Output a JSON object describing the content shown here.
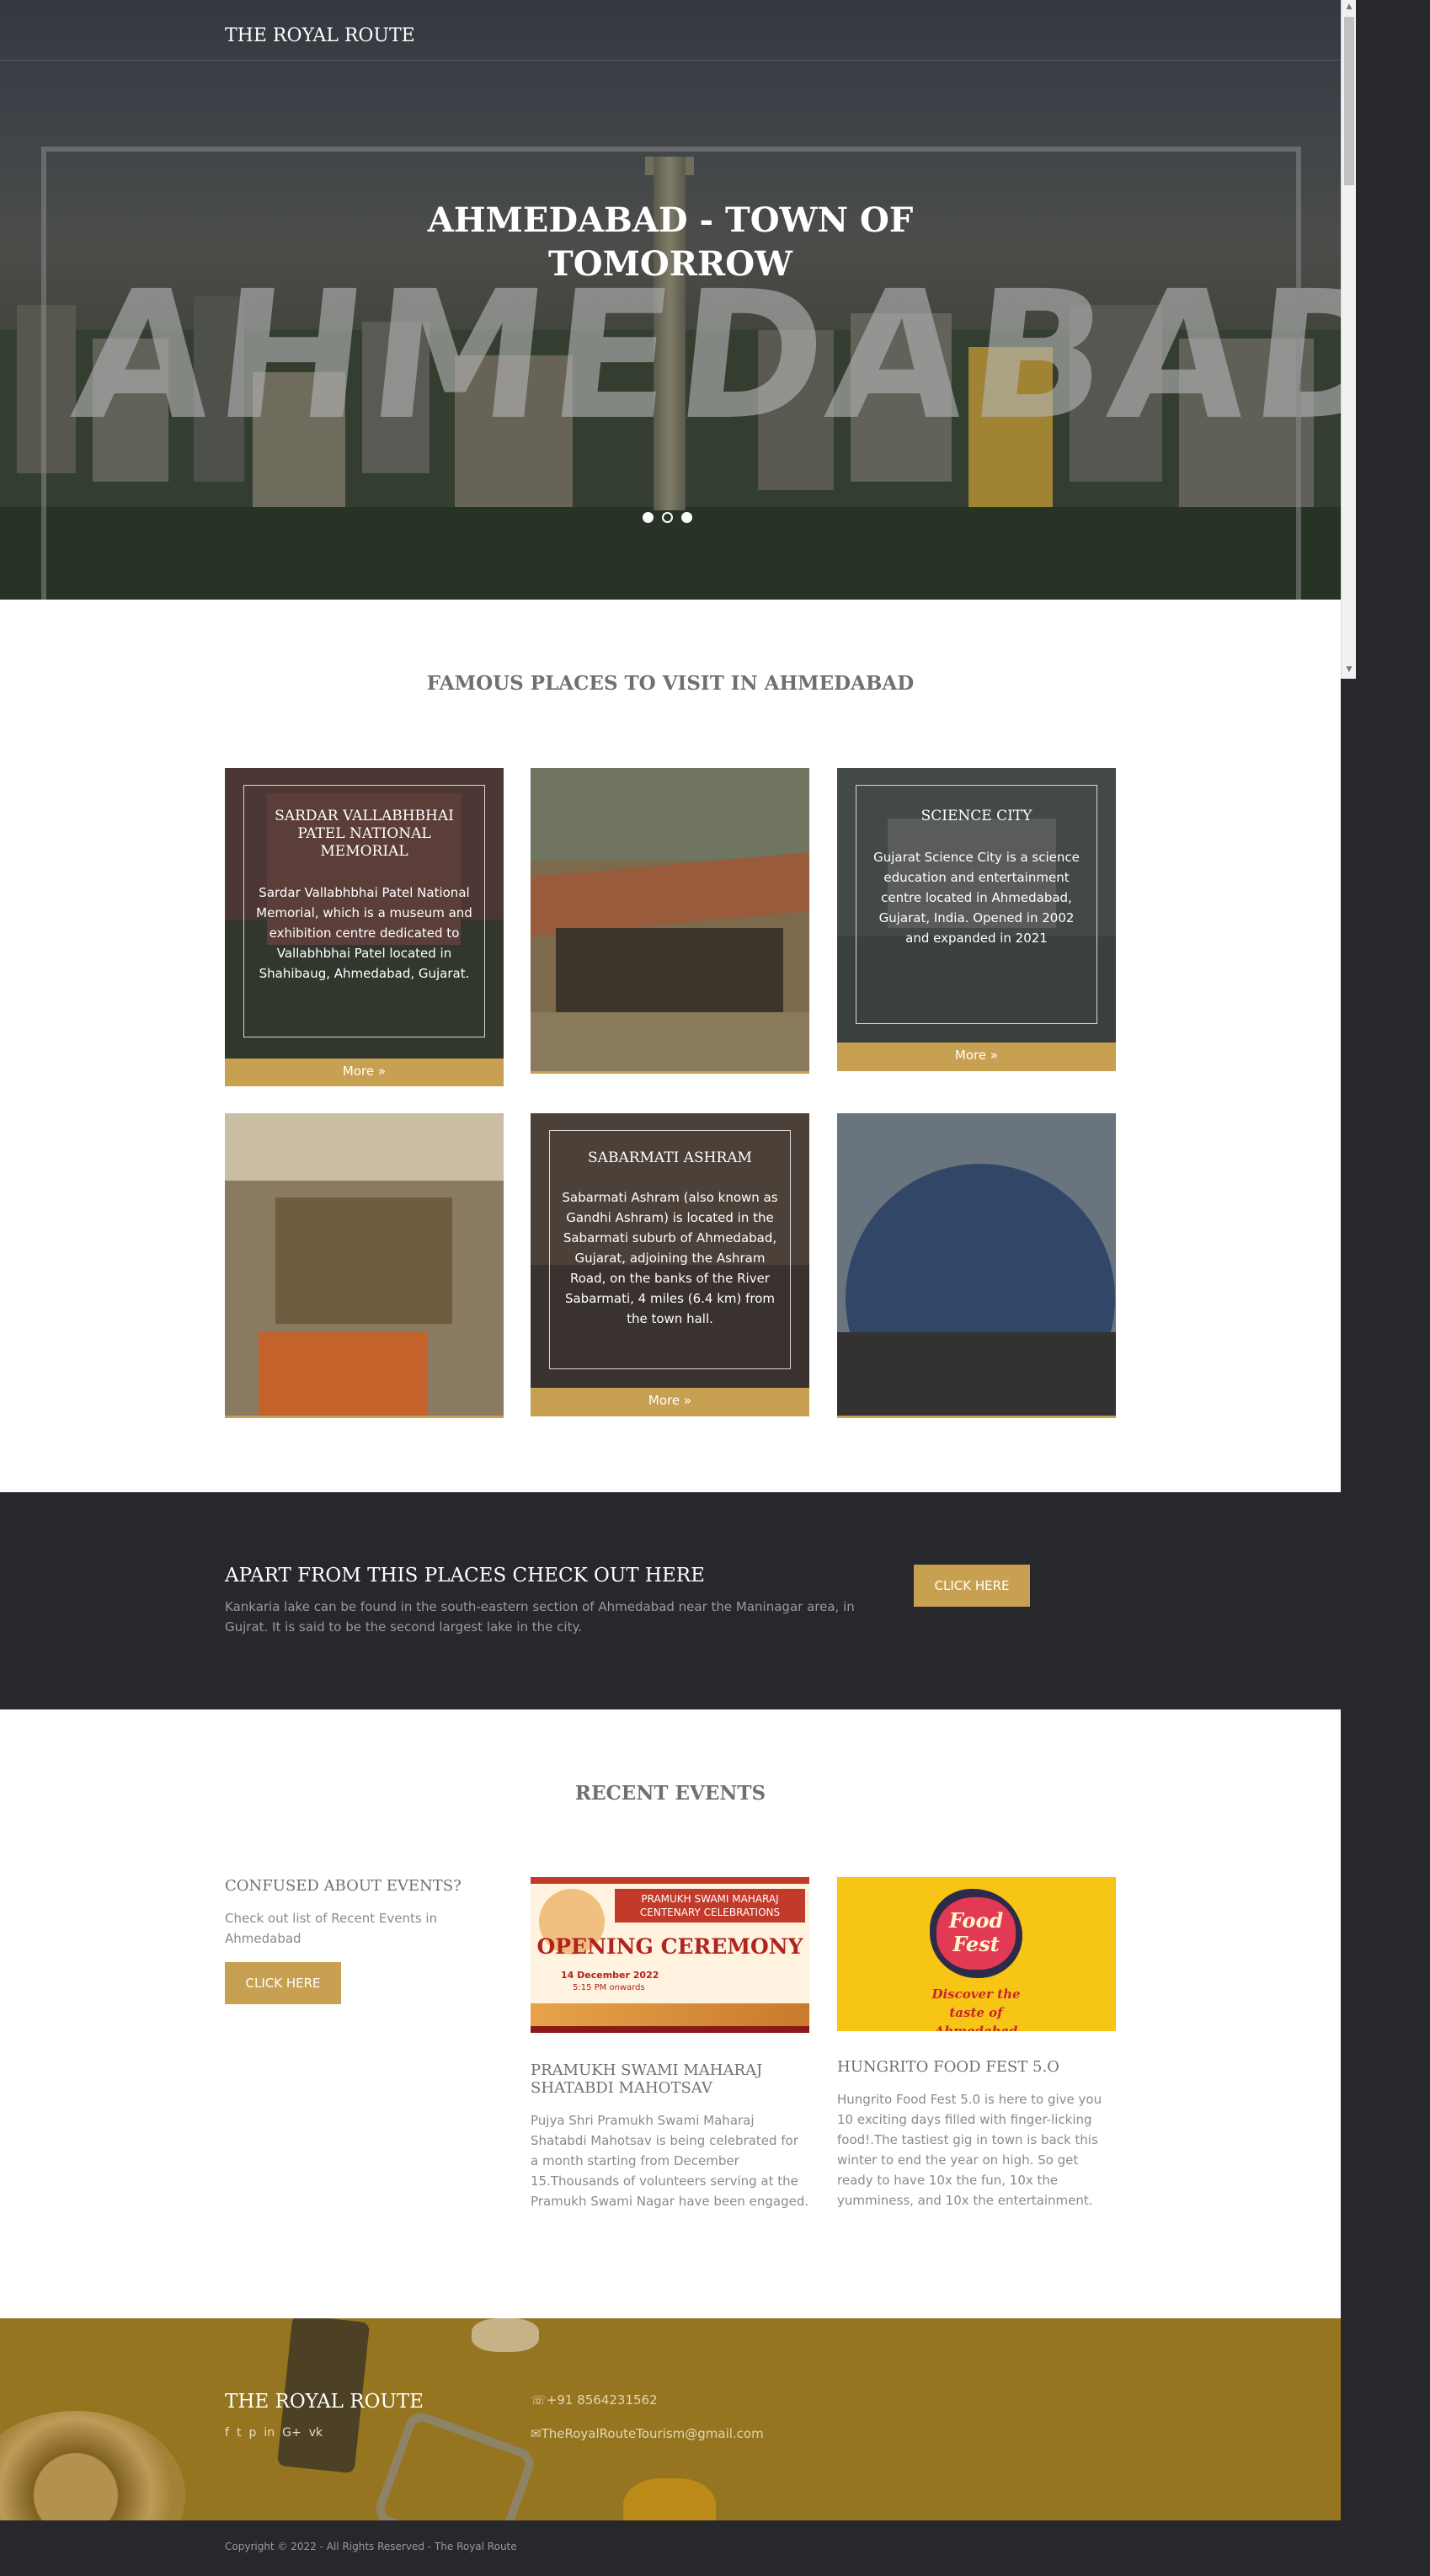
{
  "header": {
    "brand": "THE ROYAL ROUTE"
  },
  "hero": {
    "title_line1": "AHMEDABAD - TOWN OF",
    "title_line2": "TOMORROW",
    "background_word": "AHMEDABAD",
    "slides": 3,
    "active_slide": 1
  },
  "famous": {
    "title": "FAMOUS PLACES TO VISIT IN AHMEDABAD",
    "cards": [
      {
        "title": "SARDAR VALLABHBHAI PATEL NATIONAL MEMORIAL",
        "text": "Sardar Vallabhbhai Patel National Memorial, which is a museum and exhibition centre dedicated to Vallabhbhai Patel located in Shahibaug, Ahmedabad, Gujarat.",
        "more": "More »"
      },
      {
        "title": "",
        "text": "",
        "more": ""
      },
      {
        "title": "SCIENCE CITY",
        "text": "Gujarat Science City is a science education and entertainment centre located in Ahmedabad, Gujarat, India. Opened in 2002 and expanded in 2021",
        "more": "More »"
      },
      {
        "title": "",
        "text": "",
        "more": ""
      },
      {
        "title": "SABARMATI ASHRAM",
        "text": "Sabarmati Ashram (also known as Gandhi Ashram) is located in the Sabarmati suburb of Ahmedabad, Gujarat, adjoining the Ashram Road, on the banks of the River Sabarmati, 4 miles (6.4 km) from the town hall.",
        "more": "More »"
      },
      {
        "title": "",
        "text": "",
        "more": ""
      }
    ]
  },
  "cta": {
    "title": "APART FROM THIS PLACES CHECK OUT HERE",
    "text": "Kankaria lake can be found in the south-eastern section of Ahmedabad near the Maninagar area, in Gujrat. It is said to be the second largest lake in the city.",
    "button": "CLICK HERE"
  },
  "events": {
    "title": "RECENT EVENTS",
    "intro_title": "CONFUSED ABOUT EVENTS?",
    "intro_text": "Check out list of Recent Events in Ahmedabad",
    "intro_button": "CLICK HERE",
    "items": [
      {
        "title": "PRAMUKH SWAMI MAHARAJ SHATABDI MAHOTSAV",
        "text": "Pujya Shri Pramukh Swami Maharaj Shatabdi Mahotsav is being celebrated for a month starting from December 15.Thousands of volunteers serving at the Pramukh Swami Nagar have been engaged.",
        "poster_heading": "PRAMUKH SWAMI MAHARAJ CENTENARY CELEBRATIONS",
        "poster_main": "OPENING CEREMONY",
        "poster_date": "14 December 2022",
        "poster_time": "5:15 PM onwards"
      },
      {
        "title": "HUNGRITO FOOD FEST 5.O",
        "text": "Hungrito Food Fest 5.0 is here to give you 10 exciting days filled with finger-licking food!.The tastiest gig in town is back this winter to end the year on high. So get ready to have 10x the fun, 10x the yumminess, and 10x the entertainment.",
        "poster_logo_line1": "Food",
        "poster_logo_line2": "Fest",
        "poster_tagline": "Discover the taste of Ahmedabad"
      }
    ]
  },
  "footer": {
    "brand": "THE ROYAL ROUTE",
    "social": [
      "f",
      "t",
      "p",
      "in",
      "G+",
      "vk"
    ],
    "phone": "+91 8564231562",
    "email": "TheRoyalRouteTourism@gmail.com",
    "copyright": "Copyright © 2022 - All Rights Reserved - The Royal Route"
  },
  "colors": {
    "accent": "#c8a052",
    "dark": "#27282c",
    "footer": "#9a7a24"
  }
}
